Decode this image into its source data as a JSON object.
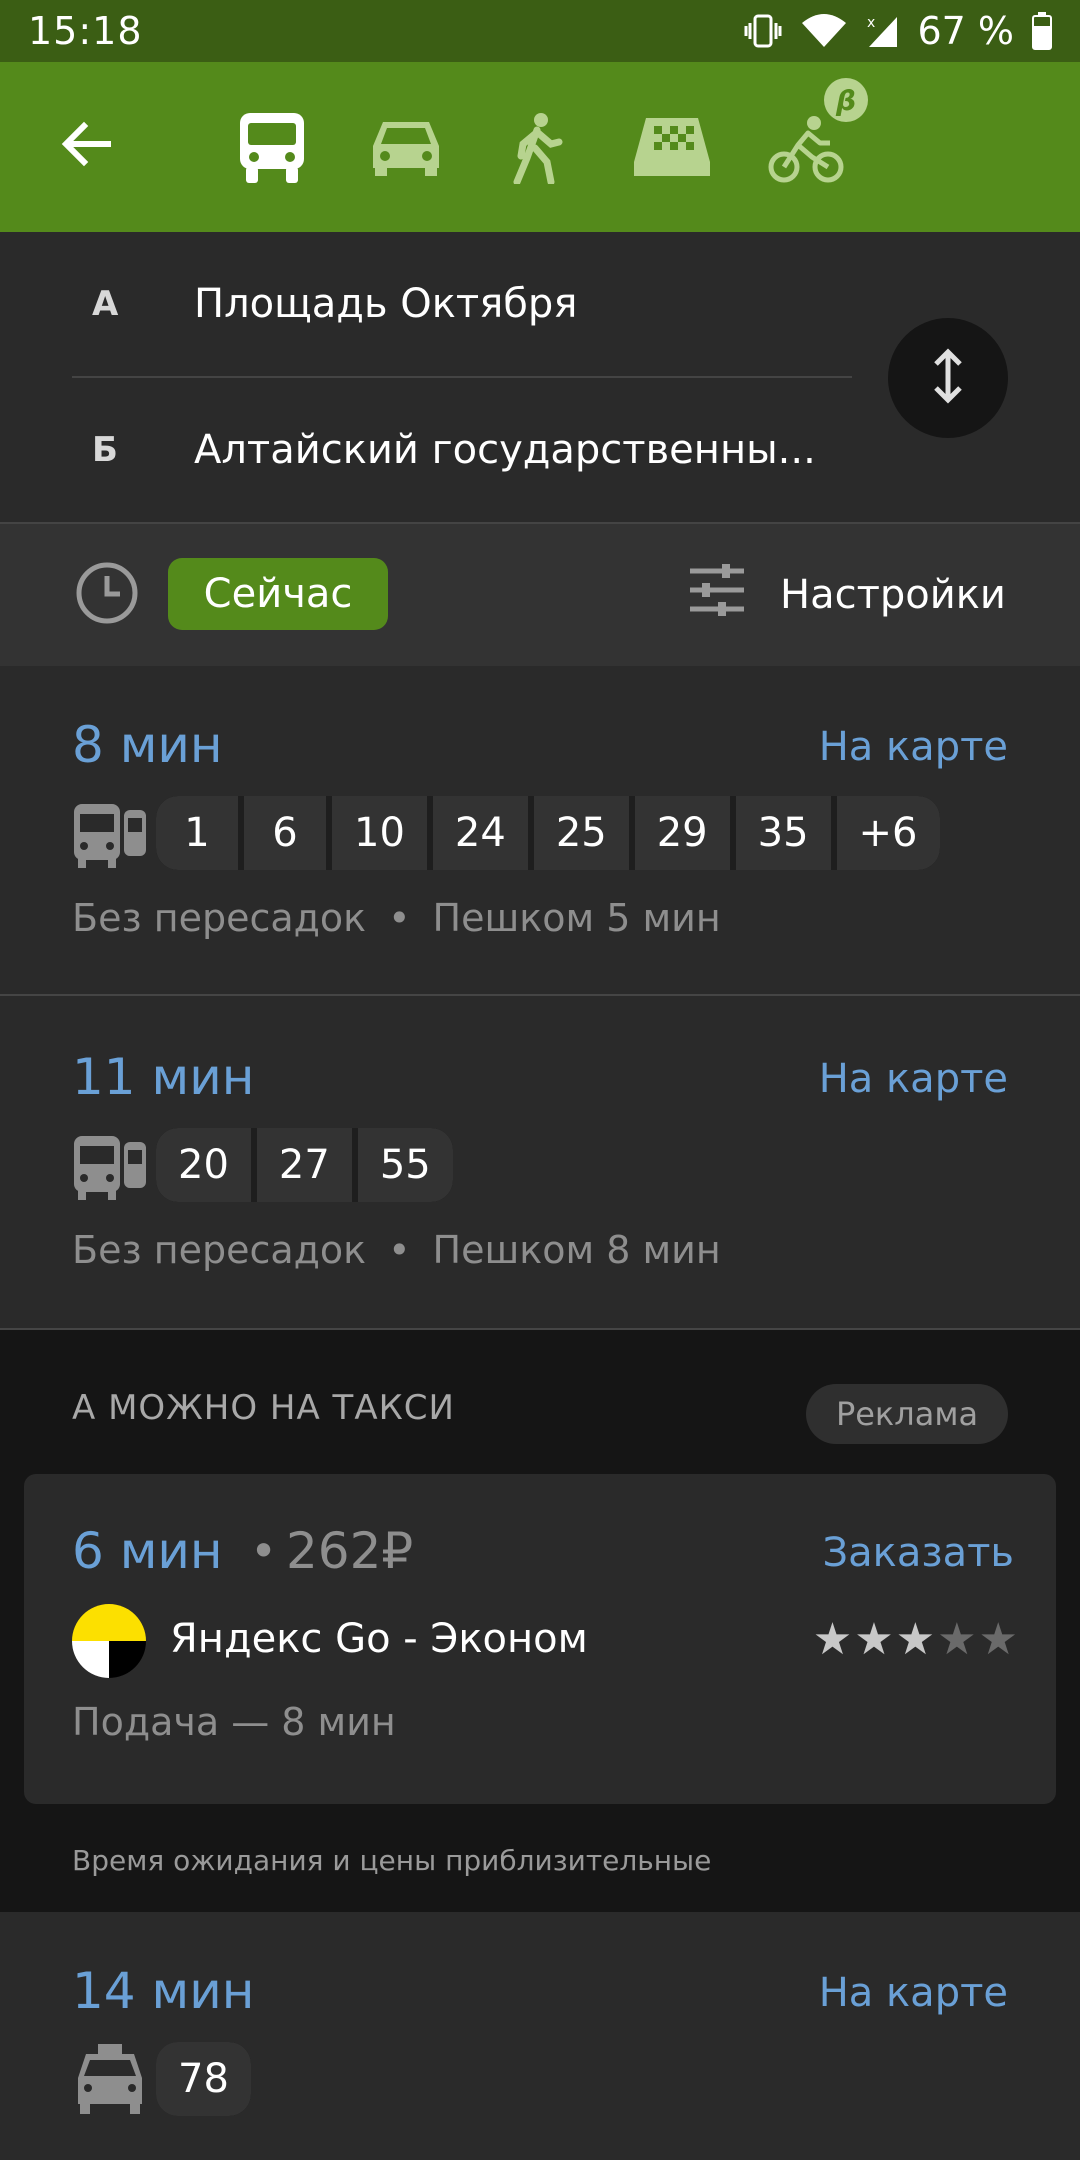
{
  "status_bar": {
    "time": "15:18",
    "battery": "67 %"
  },
  "toolbar": {
    "modes": [
      "bus-icon",
      "car-icon",
      "walk-icon",
      "taxi-icon",
      "bike-icon"
    ],
    "beta": "β"
  },
  "route": {
    "from_letter": "А",
    "from": "Площадь Октября",
    "to_letter": "Б",
    "to": "Алтайский государственны..."
  },
  "time_bar": {
    "now_label": "Сейчас",
    "settings_label": "Настройки"
  },
  "routes": [
    {
      "duration": "8 мин",
      "map_link": "На карте",
      "lines": [
        "1",
        "6",
        "10",
        "24",
        "25",
        "29",
        "35",
        "+6"
      ],
      "transfers": "Без пересадок",
      "walk": "Пешком 5 мин"
    },
    {
      "duration": "11 мин",
      "map_link": "На карте",
      "lines": [
        "20",
        "27",
        "55"
      ],
      "transfers": "Без пересадок",
      "walk": "Пешком 8 мин"
    },
    {
      "duration": "14 мин",
      "map_link": "На карте",
      "lines": [
        "78"
      ]
    }
  ],
  "taxi": {
    "heading": "А МОЖНО НА ТАКСИ",
    "ad_label": "Реклама",
    "duration": "6 мин",
    "dot": "•",
    "price": "262₽",
    "order_label": "Заказать",
    "service": "Яндекс Go - Эконом",
    "rating": 2.5,
    "pickup": "Подача — 8 мин",
    "note": "Время ожидания и цены приблизительные"
  },
  "colors": {
    "accent_green": "#548a1b",
    "link_blue": "#6aa0d6",
    "status_green": "#3b5e14"
  }
}
